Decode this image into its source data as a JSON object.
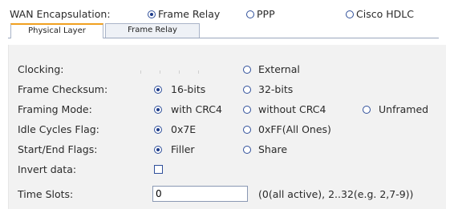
{
  "encapsulation": {
    "label": "WAN Encapsulation:",
    "options": [
      {
        "label": "Frame Relay",
        "selected": true
      },
      {
        "label": "PPP",
        "selected": false
      },
      {
        "label": "Cisco HDLC",
        "selected": false
      }
    ]
  },
  "tabs": [
    {
      "label": "Physical Layer",
      "active": true
    },
    {
      "label": "Frame Relay",
      "active": false
    }
  ],
  "fields": {
    "clocking": {
      "label": "Clocking:",
      "options": [
        {
          "label": "External",
          "selected": false
        }
      ]
    },
    "frame_checksum": {
      "label": "Frame Checksum:",
      "options": [
        {
          "label": "16-bits",
          "selected": true
        },
        {
          "label": "32-bits",
          "selected": false
        }
      ]
    },
    "framing_mode": {
      "label": "Framing Mode:",
      "options": [
        {
          "label": "with CRC4",
          "selected": true
        },
        {
          "label": "without CRC4",
          "selected": false
        },
        {
          "label": "Unframed",
          "selected": false
        }
      ]
    },
    "idle_cycles": {
      "label": "Idle Cycles Flag:",
      "options": [
        {
          "label": "0x7E",
          "selected": true
        },
        {
          "label": "0xFF(All Ones)",
          "selected": false
        }
      ]
    },
    "start_end": {
      "label": "Start/End Flags:",
      "options": [
        {
          "label": "Filler",
          "selected": true
        },
        {
          "label": "Share",
          "selected": false
        }
      ]
    },
    "invert_data": {
      "label": "Invert data:",
      "checked": false
    },
    "time_slots": {
      "label": "Time Slots:",
      "value": "0",
      "hint": "(0(all active), 2..32(e.g. 2,7-9))"
    }
  }
}
